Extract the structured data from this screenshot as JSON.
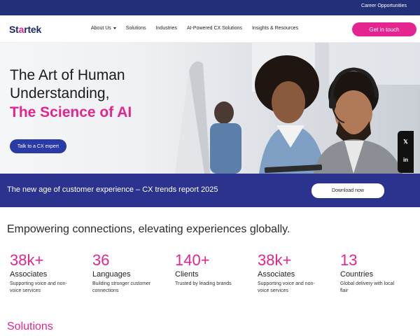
{
  "topbar": {
    "career_link": "Career Opportunities"
  },
  "header": {
    "logo": {
      "text_pre": "St",
      "text_dot": "a",
      "text_post": "rtek"
    },
    "nav": [
      {
        "label": "About Us",
        "has_dropdown": true
      },
      {
        "label": "Solutions",
        "has_dropdown": false
      },
      {
        "label": "Industries",
        "has_dropdown": false
      },
      {
        "label": "AI-Powered CX Solutions",
        "has_dropdown": false
      },
      {
        "label": "Insights & Resources",
        "has_dropdown": false
      }
    ],
    "cta_label": "Get in touch"
  },
  "hero": {
    "title": "The Art of Human Understanding,",
    "subtitle": "The Science of AI",
    "button_label": "Talk to a CX expert",
    "social": [
      {
        "icon": "x-icon",
        "glyph": "𝕏"
      },
      {
        "icon": "linkedin-icon",
        "glyph": "in"
      }
    ]
  },
  "banner": {
    "text": "The new age of customer experience – CX trends report 2025",
    "button_label": "Download now"
  },
  "tagline": "Empowering connections, elevating experiences globally.",
  "stats": [
    {
      "value": "38k+",
      "label": "Associates",
      "desc": "Supporting voice and non-voice services"
    },
    {
      "value": "36",
      "label": "Languages",
      "desc": "Building stronger customer connections"
    },
    {
      "value": "140+",
      "label": "Clients",
      "desc": "Trusted by leading brands"
    },
    {
      "value": "38k+",
      "label": "Associates",
      "desc": "Supporting voice and non-voice services"
    },
    {
      "value": "13",
      "label": "Countries",
      "desc": "Global delivery with local flair"
    }
  ],
  "solutions_title": "Solutions",
  "colors": {
    "brand_navy": "#22307a",
    "brand_pink": "#e5258f",
    "banner_blue": "#2c338f",
    "button_blue": "#2a3aa6"
  }
}
